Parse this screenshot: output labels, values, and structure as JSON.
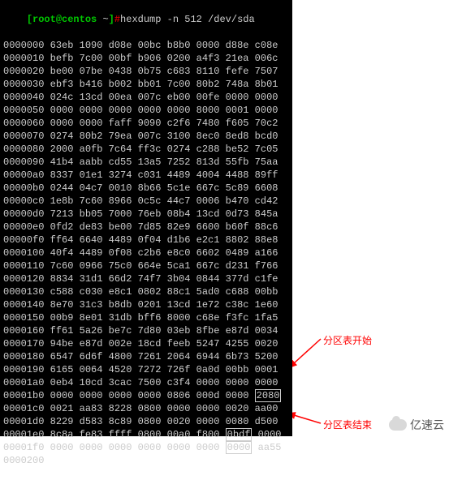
{
  "prompt": {
    "user": "[root@centos",
    "path": "~",
    "bracket_close": "]",
    "hash": "#",
    "command": "hexdump -n 512 /dev/sda"
  },
  "dump": [
    {
      "offset": "0000000",
      "hex": "63eb 1090 d08e 00bc b8b0 0000 d88e c08e"
    },
    {
      "offset": "0000010",
      "hex": "befb 7c00 00bf b906 0200 a4f3 21ea 006c"
    },
    {
      "offset": "0000020",
      "hex": "be00 07be 0438 0b75 c683 8110 fefe 7507"
    },
    {
      "offset": "0000030",
      "hex": "ebf3 b416 b002 bb01 7c00 80b2 748a 8b01"
    },
    {
      "offset": "0000040",
      "hex": "024c 13cd 00ea 007c eb00 00fe 0000 0000"
    },
    {
      "offset": "0000050",
      "hex": "0000 0000 0000 0000 0000 8000 0001 0000"
    },
    {
      "offset": "0000060",
      "hex": "0000 0000 faff 9090 c2f6 7480 f605 70c2"
    },
    {
      "offset": "0000070",
      "hex": "0274 80b2 79ea 007c 3100 8ec0 8ed8 bcd0"
    },
    {
      "offset": "0000080",
      "hex": "2000 a0fb 7c64 ff3c 0274 c288 be52 7c05"
    },
    {
      "offset": "0000090",
      "hex": "41b4 aabb cd55 13a5 7252 813d 55fb 75aa"
    },
    {
      "offset": "00000a0",
      "hex": "8337 01e1 3274 c031 4489 4004 4488 89ff"
    },
    {
      "offset": "00000b0",
      "hex": "0244 04c7 0010 8b66 5c1e 667c 5c89 6608"
    },
    {
      "offset": "00000c0",
      "hex": "1e8b 7c60 8966 0c5c 44c7 0006 b470 cd42"
    },
    {
      "offset": "00000d0",
      "hex": "7213 bb05 7000 76eb 08b4 13cd 0d73 845a"
    },
    {
      "offset": "00000e0",
      "hex": "0fd2 de83 be00 7d85 82e9 6600 b60f 88c6"
    },
    {
      "offset": "00000f0",
      "hex": "ff64 6640 4489 0f04 d1b6 e2c1 8802 88e8"
    },
    {
      "offset": "0000100",
      "hex": "40f4 4489 0f08 c2b6 e8c0 6602 0489 a166"
    },
    {
      "offset": "0000110",
      "hex": "7c60 0966 75c0 664e 5ca1 667c d231 f766"
    },
    {
      "offset": "0000120",
      "hex": "8834 31d1 66d2 74f7 3b04 0844 377d c1fe"
    },
    {
      "offset": "0000130",
      "hex": "c588 c030 e8c1 0802 88c1 5ad0 c688 00bb"
    },
    {
      "offset": "0000140",
      "hex": "8e70 31c3 b8db 0201 13cd 1e72 c38c 1e60"
    },
    {
      "offset": "0000150",
      "hex": "00b9 8e01 31db bff6 8000 c68e f3fc 1fa5"
    },
    {
      "offset": "0000160",
      "hex": "ff61 5a26 be7c 7d80 03eb 8fbe e87d 0034"
    },
    {
      "offset": "0000170",
      "hex": "94be e87d 002e 18cd feeb 5247 4255 0020"
    },
    {
      "offset": "0000180",
      "hex": "6547 6d6f 4800 7261 2064 6944 6b73 5200"
    },
    {
      "offset": "0000190",
      "hex": "6165 0064 4520 7272 726f 0a0d 00bb 0001"
    },
    {
      "offset": "00001a0",
      "hex": "0eb4 10cd 3cac 7500 c3f4 0000 0000 0000"
    },
    {
      "offset": "00001b0",
      "hex": "0000 0000 0000 0000 0806 000d 0000 ",
      "hl1": "2080"
    },
    {
      "offset": "00001c0",
      "hex": "0021 aa83 8228 0800 0000 0000 0020 aa00"
    },
    {
      "offset": "00001d0",
      "hex": "8229 d583 8c89 0800 0020 0000 0080 d500"
    },
    {
      "offset": "00001e0",
      "hex": "8c8a fe83 ffff 0800 00a0 f800 ",
      "hl2": "0bdf",
      "rest2": " 0000"
    },
    {
      "offset": "00001f0",
      "hex": "0000 0000 0000 0000 0000 0000 ",
      "hl3": "0000",
      "rest3": " aa55"
    },
    {
      "offset": "0000200",
      "hex": ""
    }
  ],
  "annotations": {
    "start_label": "分区表开始",
    "end_label": "分区表结束"
  },
  "watermark": "亿速云"
}
